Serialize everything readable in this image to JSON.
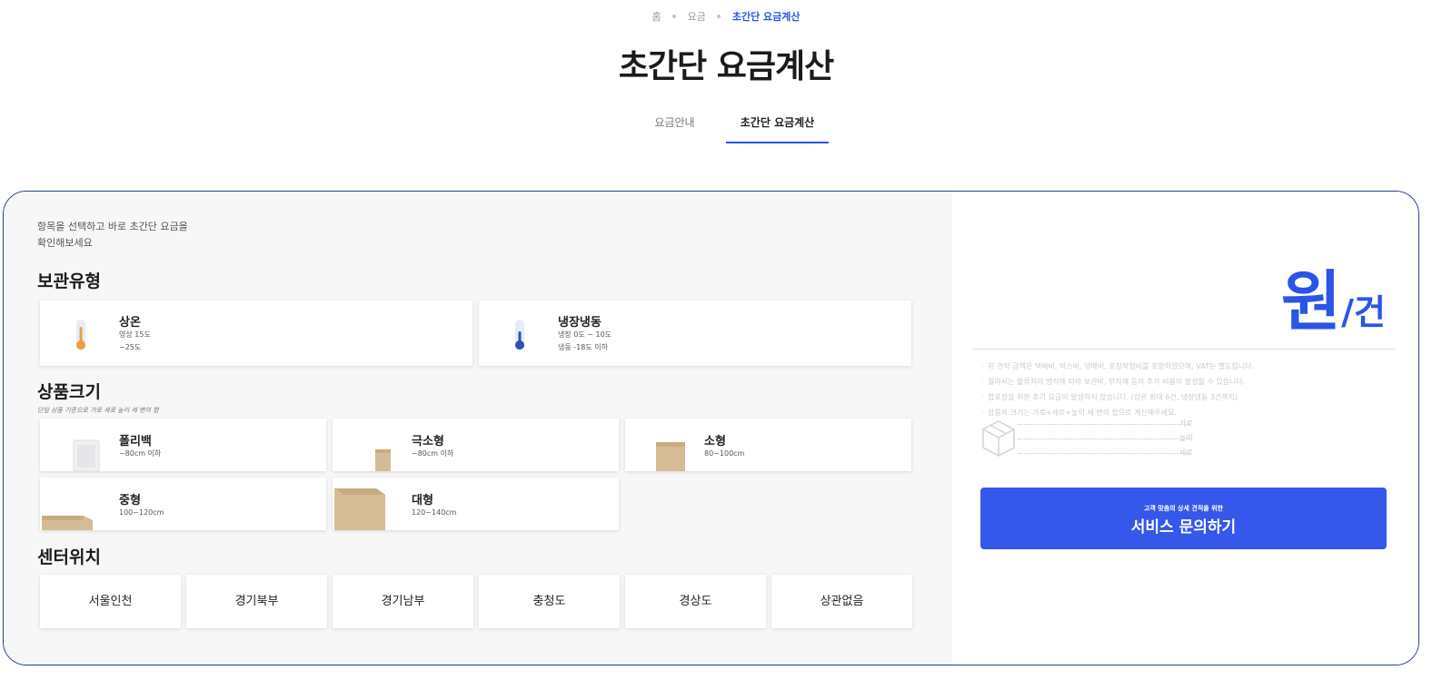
{
  "breadcrumb": {
    "home": "홈",
    "fee": "요금",
    "current": "초간단 요금계산"
  },
  "page_title": "초간단 요금계산",
  "tabs": [
    {
      "label": "요금안내",
      "active": false
    },
    {
      "label": "초간단 요금계산",
      "active": true
    }
  ],
  "intro": {
    "line1": "항목을 선택하고 바로 초간단 요금을",
    "line2": "확인해보세요"
  },
  "storage": {
    "title": "보관유형",
    "options": [
      {
        "title": "상온",
        "sub1": "영상 15도",
        "sub2": "~25도",
        "icon": "thermometer-warm-icon",
        "color": "#e9a23b"
      },
      {
        "title": "냉장냉동",
        "sub1": "냉장 0도 ~ 10도",
        "sub2": "냉동 -18도 이하",
        "icon": "thermometer-cold-icon",
        "color": "#2f4fb8"
      }
    ]
  },
  "size": {
    "title": "상품크기",
    "note": "단일 상품 기준으로 가로 세로 높이 세 변의 합",
    "options": [
      {
        "title": "폴리백",
        "sub": "~80cm 이하",
        "icon": "polybag-icon"
      },
      {
        "title": "극소형",
        "sub": "~80cm 이하",
        "icon": "extra-small-box-icon"
      },
      {
        "title": "소형",
        "sub": "80~100cm",
        "icon": "small-box-icon"
      },
      {
        "title": "중형",
        "sub": "100~120cm",
        "icon": "medium-box-icon"
      },
      {
        "title": "대형",
        "sub": "120~140cm",
        "icon": "large-box-icon"
      }
    ]
  },
  "center": {
    "title": "센터위치",
    "options": [
      "서울인천",
      "경기북부",
      "경기남부",
      "충청도",
      "경상도",
      "상관없음"
    ]
  },
  "result": {
    "unit_won": "원",
    "unit_per": "/건",
    "notes": [
      "위 견적 금액은 택배비, 박스비, 냉매비, 포장작업비를 포함하였으며, VAT는 별도입니다.",
      "월마시는 물류처리 방식에 따라 보관비, 부자재 등의 추가 비용이 발생할 수 있습니다.",
      "합포장을 위한 추가 요금이 발생하지 않습니다. (상온 최대 6건, 냉장냉동 3건까지)",
      "상품의 크기는 가로+세로+높이 세 변의 합으로 계산해주세요."
    ],
    "dims": [
      "가로",
      "높이",
      "세로"
    ],
    "cta_small": "고객 맞춤의 상세 견적을 위한",
    "cta_big": "서비스 문의하기"
  },
  "colors": {
    "accent": "#2a55e5",
    "button": "#3557ea",
    "border": "#26408a"
  }
}
